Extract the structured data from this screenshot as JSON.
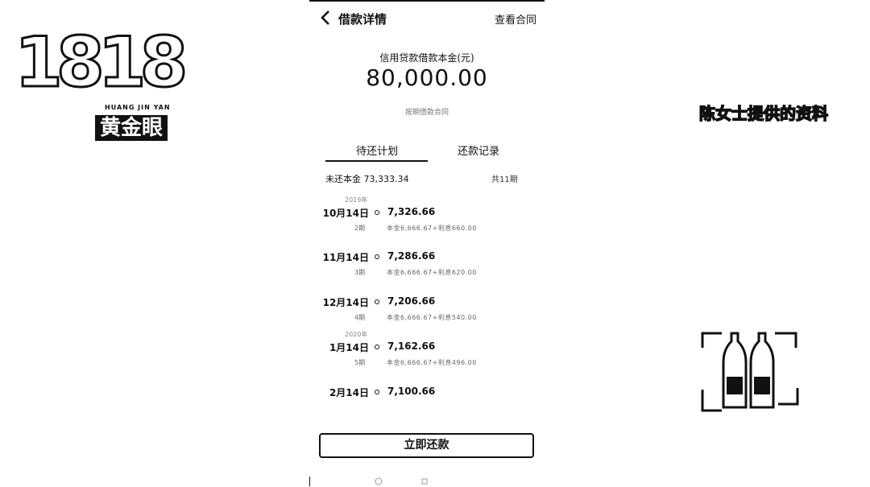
{
  "overlay": {
    "logo_digits": "1818",
    "logo_pinyin": "HUANG JIN YAN",
    "logo_name": "黄金眼",
    "caption": "陈女士提供的资料"
  },
  "nav": {
    "title": "借款详情",
    "contract_link": "查看合同"
  },
  "loan": {
    "principal_label": "信用贷款借款本金(元)",
    "principal_amount": "80,000.00",
    "sub_label": "按期借款合同"
  },
  "tabs": {
    "plan": "待还计划",
    "record": "还款记录"
  },
  "summary": {
    "remaining": "未还本金 73,333.34",
    "periods": "共11期"
  },
  "schedule": [
    {
      "year": "2019年",
      "date": "10月14日",
      "amount": "7,326.66",
      "idx": "2期",
      "detail": "本金6,666.67+利息660.00"
    },
    {
      "year": "",
      "date": "11月14日",
      "amount": "7,286.66",
      "idx": "3期",
      "detail": "本金6,666.67+利息620.00"
    },
    {
      "year": "",
      "date": "12月14日",
      "amount": "7,206.66",
      "idx": "4期",
      "detail": "本金6,666.67+利息540.00"
    },
    {
      "year": "2020年",
      "date": "1月14日",
      "amount": "7,162.66",
      "idx": "5期",
      "detail": "本金6,666.67+利息496.00"
    },
    {
      "year": "",
      "date": "2月14日",
      "amount": "7,100.66",
      "idx": "",
      "detail": ""
    }
  ],
  "action": {
    "repay_button": "立即还款"
  },
  "icons": [
    "back-icon",
    "bottle-icon"
  ],
  "colors": {
    "ink": "#111111",
    "background": "#ffffff"
  }
}
